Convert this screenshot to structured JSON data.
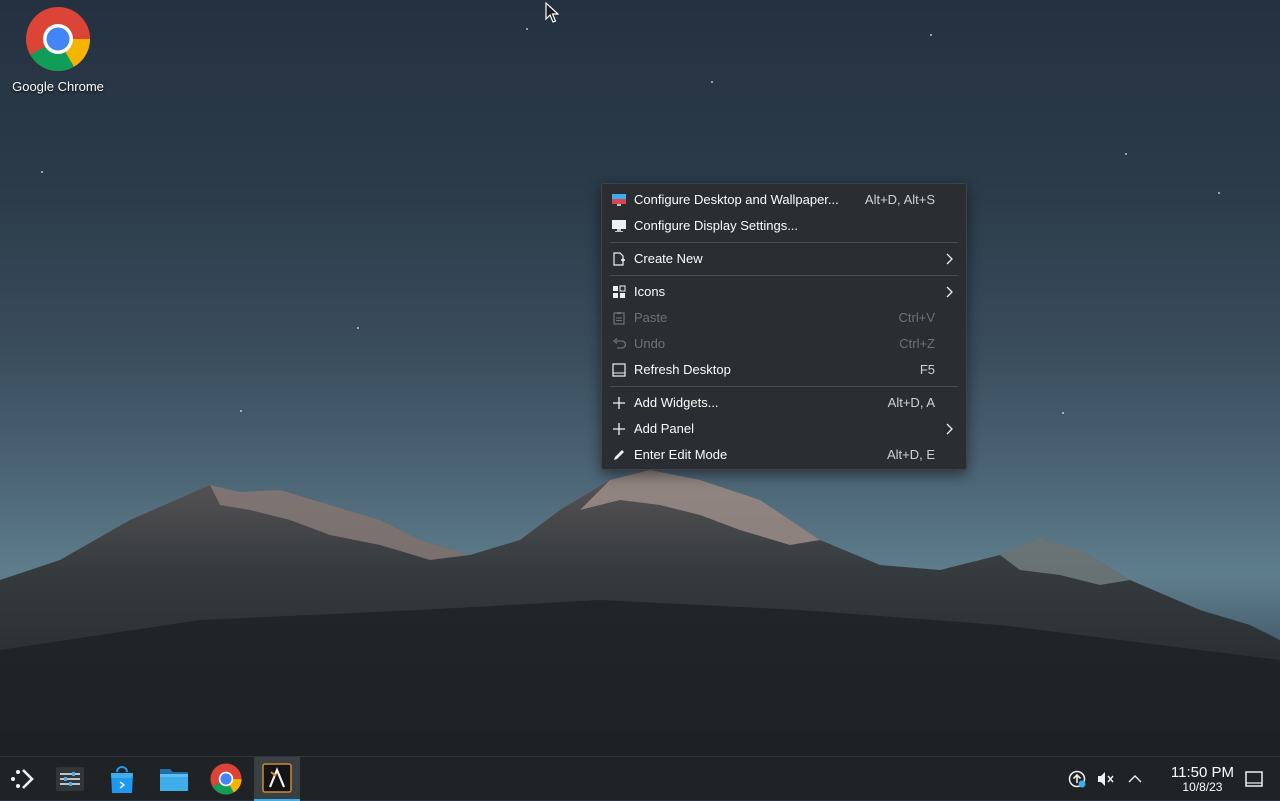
{
  "desktop": {
    "icons": [
      {
        "label": "Google Chrome",
        "icon": "chrome-icon"
      }
    ]
  },
  "context_menu": {
    "items": [
      {
        "label": "Configure Desktop and Wallpaper...",
        "shortcut": "Alt+D, Alt+S",
        "icon": "wallpaper-icon",
        "submenu": false,
        "enabled": true
      },
      {
        "label": "Configure Display Settings...",
        "shortcut": "",
        "icon": "display-icon",
        "submenu": false,
        "enabled": true
      },
      {
        "label": "Create New",
        "shortcut": "",
        "icon": "new-document-icon",
        "submenu": true,
        "enabled": true
      },
      {
        "label": "Icons",
        "shortcut": "",
        "icon": "grid-icon",
        "submenu": true,
        "enabled": true
      },
      {
        "label": "Paste",
        "shortcut": "Ctrl+V",
        "icon": "paste-icon",
        "submenu": false,
        "enabled": false
      },
      {
        "label": "Undo",
        "shortcut": "Ctrl+Z",
        "icon": "undo-icon",
        "submenu": false,
        "enabled": false
      },
      {
        "label": "Refresh Desktop",
        "shortcut": "F5",
        "icon": "refresh-desktop-icon",
        "submenu": false,
        "enabled": true
      },
      {
        "label": "Add Widgets...",
        "shortcut": "Alt+D, A",
        "icon": "plus-icon",
        "submenu": false,
        "enabled": true
      },
      {
        "label": "Add Panel",
        "shortcut": "",
        "icon": "plus-icon",
        "submenu": true,
        "enabled": true
      },
      {
        "label": "Enter Edit Mode",
        "shortcut": "Alt+D, E",
        "icon": "pencil-icon",
        "submenu": false,
        "enabled": true
      }
    ]
  },
  "taskbar": {
    "apps": [
      {
        "icon": "application-launcher-icon"
      },
      {
        "icon": "system-settings-icon"
      },
      {
        "icon": "discover-store-icon"
      },
      {
        "icon": "file-manager-icon"
      },
      {
        "icon": "chrome-icon"
      },
      {
        "icon": "terminal-app-icon",
        "active": true
      }
    ],
    "tray": [
      "updates-icon",
      "volume-muted-icon",
      "show-hidden-icon"
    ],
    "clock": {
      "time": "11:50 PM",
      "date": "10/8/23"
    },
    "show_desktop_icon": "show-desktop-icon"
  },
  "colors": {
    "accent": "#3daee9",
    "menu_bg": "#2a2e32",
    "panel_bg": "#202326"
  }
}
